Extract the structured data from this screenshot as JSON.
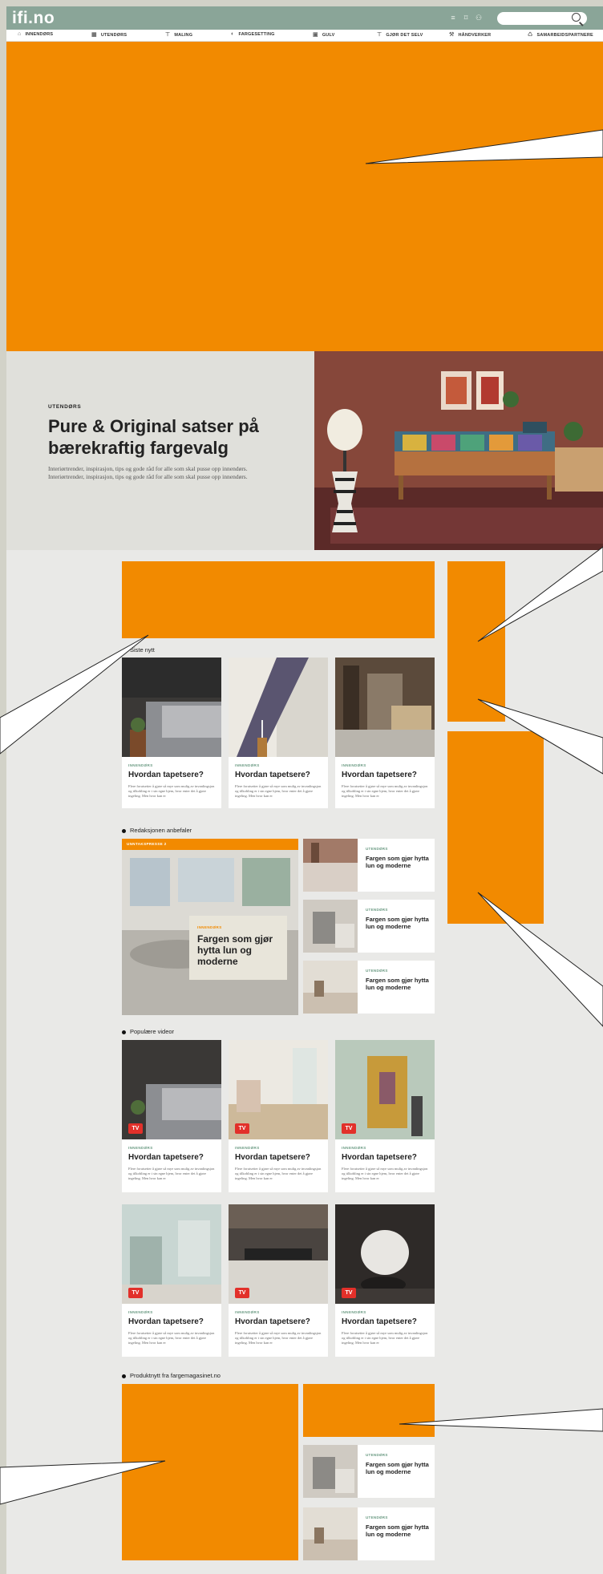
{
  "header": {
    "logo": "ifi.no",
    "search_placeholder": "",
    "nav": [
      {
        "label": "INNENDØRS",
        "icon": "house-icon",
        "glyph": "⌂"
      },
      {
        "label": "UTENDØRS",
        "icon": "building-icon",
        "glyph": "▦"
      },
      {
        "label": "MALING",
        "icon": "paint-roller-icon",
        "glyph": "⊤"
      },
      {
        "label": "FARGESETTING",
        "icon": "palette-icon",
        "glyph": "◐"
      },
      {
        "label": "GULV",
        "icon": "floor-icon",
        "glyph": "▣"
      },
      {
        "label": "GJØR DET SELV",
        "icon": "tools-icon",
        "glyph": "⊤"
      },
      {
        "label": "HÅNDVERKER",
        "icon": "hammer-icon",
        "glyph": "⚒"
      },
      {
        "label": "SAMARBEIDSPARTNERE",
        "icon": "partners-icon",
        "glyph": "♺"
      }
    ]
  },
  "hero": {
    "kicker": "UTENDØRS",
    "title": "Pure & Original satser på bærekraftig fargevalg",
    "subtitle": "Interiørtrender, inspirasjon, tips og gode råd for alle som skal pusse opp innendørs. Interiørtrender, inspirasjon, tips og gode råd for alle som skal pusse opp innendørs."
  },
  "latest": {
    "label": "Siste nytt",
    "cards": [
      {
        "category": "INNENDØRS",
        "title": "Hvordan tapetsere?",
        "desc": "Flere forutsetter å gjøre så mye som mulig av invanlingsjon og tilkobling er i sin egne hjem, hvor enter det å gjøre ingeling. Men hvor kan er"
      },
      {
        "category": "INNENDØRS",
        "title": "Hvordan tapetsere?",
        "desc": "Flere forutsetter å gjøre så mye som mulig av invanlingsjon og tilkobling er i sin egne hjem, hvor enter det å gjøre ingeling. Men hvor kan er"
      },
      {
        "category": "INNENDØRS",
        "title": "Hvordan tapetsere?",
        "desc": "Flere forutsetter å gjøre så mye som mulig av invanlingsjon og tilkobling er i sin egne hjem, hvor enter det å gjøre ingeling. Men hvor kan er"
      }
    ]
  },
  "recommended": {
    "label": "Redaksjonen anbefaler",
    "feature": {
      "badge": "UNNTAKSPRESSE 2",
      "category": "INNENDØRS",
      "title": "Fargen som gjør hytta lun og moderne"
    },
    "items": [
      {
        "category": "UTENDØRS",
        "title": "Fargen som gjør hytta lun og moderne"
      },
      {
        "category": "UTENDØRS",
        "title": "Fargen som gjør hytta lun og moderne"
      },
      {
        "category": "UTENDØRS",
        "title": "Fargen som gjør hytta lun og moderne"
      }
    ]
  },
  "videos": {
    "label": "Populære videor",
    "tv_badge": "TV",
    "cards": [
      {
        "category": "INNENDØRS",
        "title": "Hvordan tapetsere?",
        "desc": "Flere forutsetter å gjøre så mye som mulig av invanlingsjon og tilkobling er i sin egne hjem, hvor enter det å gjøre ingeling. Men hvor kan er"
      },
      {
        "category": "INNENDØRS",
        "title": "Hvordan tapetsere?",
        "desc": "Flere forutsetter å gjøre så mye som mulig av invanlingsjon og tilkobling er i sin egne hjem, hvor enter det å gjøre ingeling. Men hvor kan er"
      },
      {
        "category": "INNENDØRS",
        "title": "Hvordan tapetsere?",
        "desc": "Flere forutsetter å gjøre så mye som mulig av invanlingsjon og tilkobling er i sin egne hjem, hvor enter det å gjøre ingeling. Men hvor kan er"
      },
      {
        "category": "INNENDØRS",
        "title": "Hvordan tapetsere?",
        "desc": "Flere forutsetter å gjøre så mye som mulig av invanlingsjon og tilkobling er i sin egne hjem, hvor enter det å gjøre ingeling. Men hvor kan er"
      },
      {
        "category": "INNENDØRS",
        "title": "Hvordan tapetsere?",
        "desc": "Flere forutsetter å gjøre så mye som mulig av invanlingsjon og tilkobling er i sin egne hjem, hvor enter det å gjøre ingeling. Men hvor kan er"
      },
      {
        "category": "INNENDØRS",
        "title": "Hvordan tapetsere?",
        "desc": "Flere forutsetter å gjøre så mye som mulig av invanlingsjon og tilkobling er i sin egne hjem, hvor enter det å gjøre ingeling. Men hvor kan er"
      }
    ]
  },
  "products": {
    "label": "Produktnytt fra fargemagasinet.no",
    "items": [
      {
        "category": "UTENDØRS",
        "title": "Fargen som gjør hytta lun og moderne"
      },
      {
        "category": "UTENDØRS",
        "title": "Fargen som gjør hytta lun og moderne"
      }
    ]
  },
  "colors": {
    "ad_orange": "#f28a00",
    "header_green": "#8aa598",
    "category_green": "#6a9a82",
    "tv_red": "#e2302a"
  }
}
